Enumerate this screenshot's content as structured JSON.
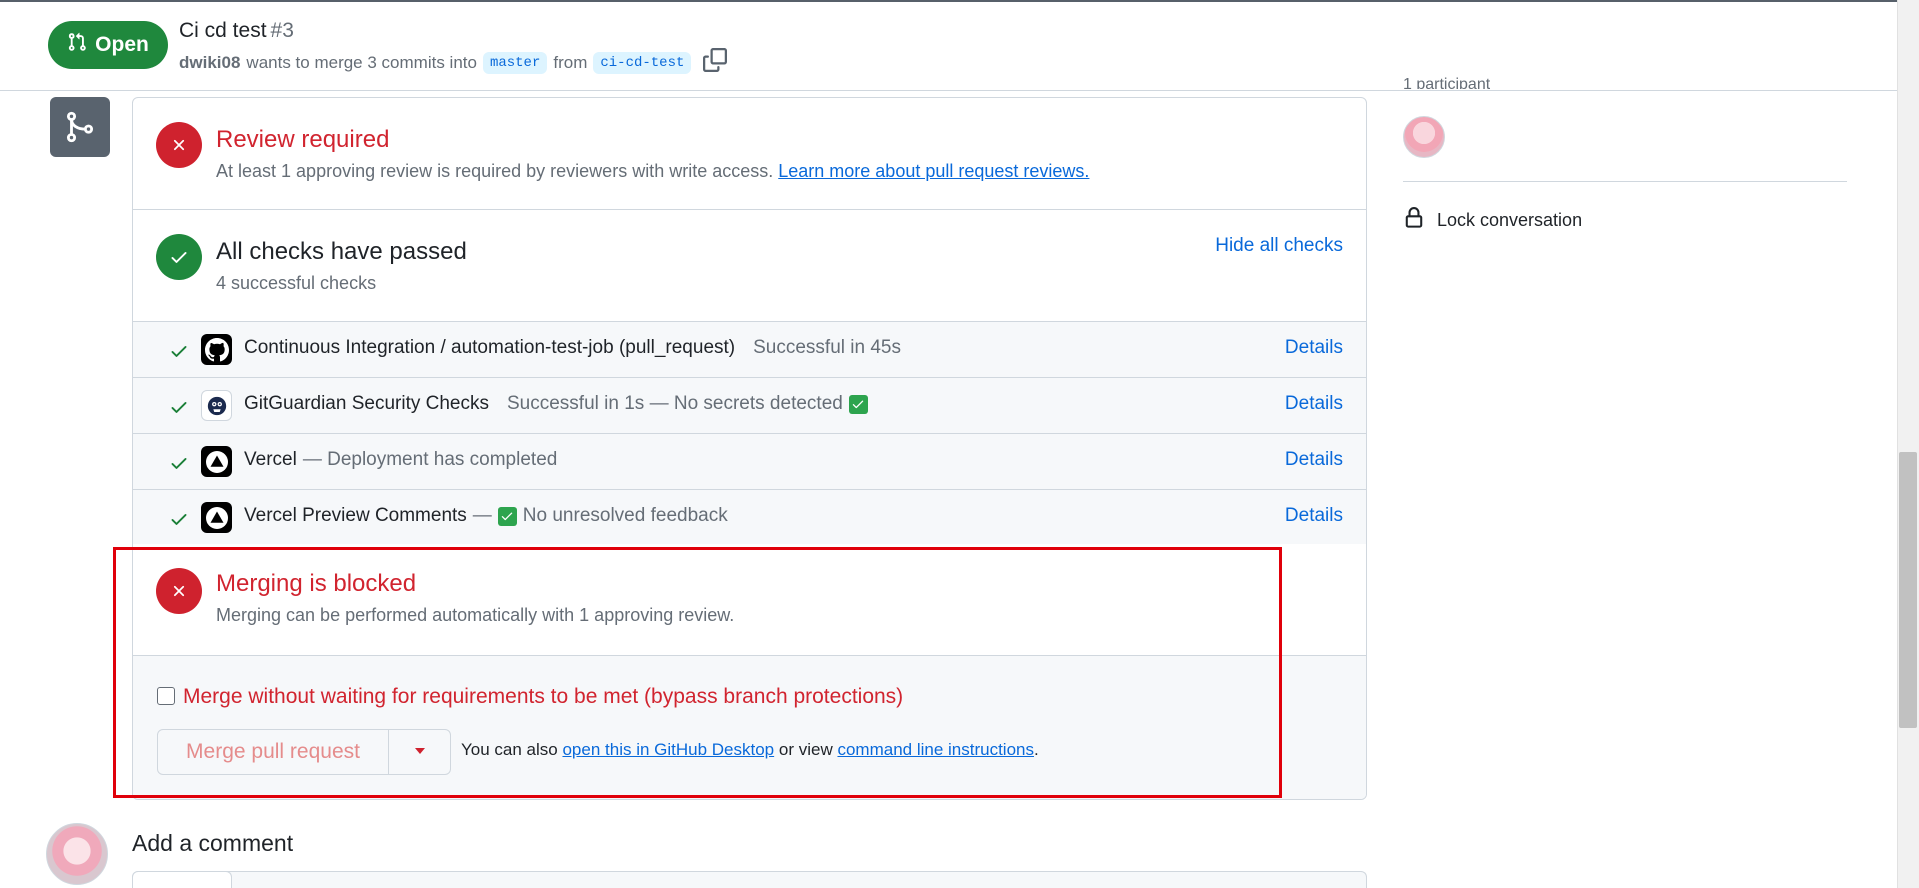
{
  "header": {
    "state_label": "Open",
    "title": "Ci cd test",
    "number": "#3",
    "author": "dwiki08",
    "merge_text": "wants to merge 3 commits into",
    "base_branch": "master",
    "from_text": "from",
    "head_branch": "ci-cd-test"
  },
  "review": {
    "title": "Review required",
    "description": "At least 1 approving review is required by reviewers with write access.",
    "learn_more_link": "Learn more about pull request reviews."
  },
  "checks": {
    "title": "All checks have passed",
    "summary": "4 successful checks",
    "hide_label": "Hide all checks",
    "rows": [
      {
        "name": "Continuous Integration / automation-test-job (pull_request)",
        "status": "Successful in 45s",
        "details": "Details",
        "logo": "github-icon"
      },
      {
        "name": "GitGuardian Security Checks",
        "status": "Successful in 1s — No secrets detected",
        "details": "Details",
        "logo": "gitguardian-icon"
      },
      {
        "name": "Vercel",
        "status": "— Deployment has completed",
        "details": "Details",
        "logo": "vercel-icon"
      },
      {
        "name": "Vercel Preview Comments",
        "status_prefix": "—",
        "status": "No unresolved feedback",
        "details": "Details",
        "logo": "vercel-icon"
      }
    ]
  },
  "blocked": {
    "title": "Merging is blocked",
    "description": "Merging can be performed automatically with 1 approving review."
  },
  "bypass": {
    "checkbox_label": "Merge without waiting for requirements to be met (bypass branch protections)",
    "checked": false
  },
  "merge": {
    "button_label": "Merge pull request",
    "also_text": "You can also",
    "desktop_link": "open this in GitHub Desktop",
    "or_view": "or view",
    "cli_link": "command line instructions",
    "period": "."
  },
  "sidebar": {
    "participants_label": "1 participant",
    "lock_label": "Lock conversation"
  },
  "comment": {
    "title": "Add a comment"
  },
  "colors": {
    "open_green": "#1f883d",
    "danger_red": "#cf222e",
    "link_blue": "#0969da",
    "annotation_red": "#e0000a"
  }
}
